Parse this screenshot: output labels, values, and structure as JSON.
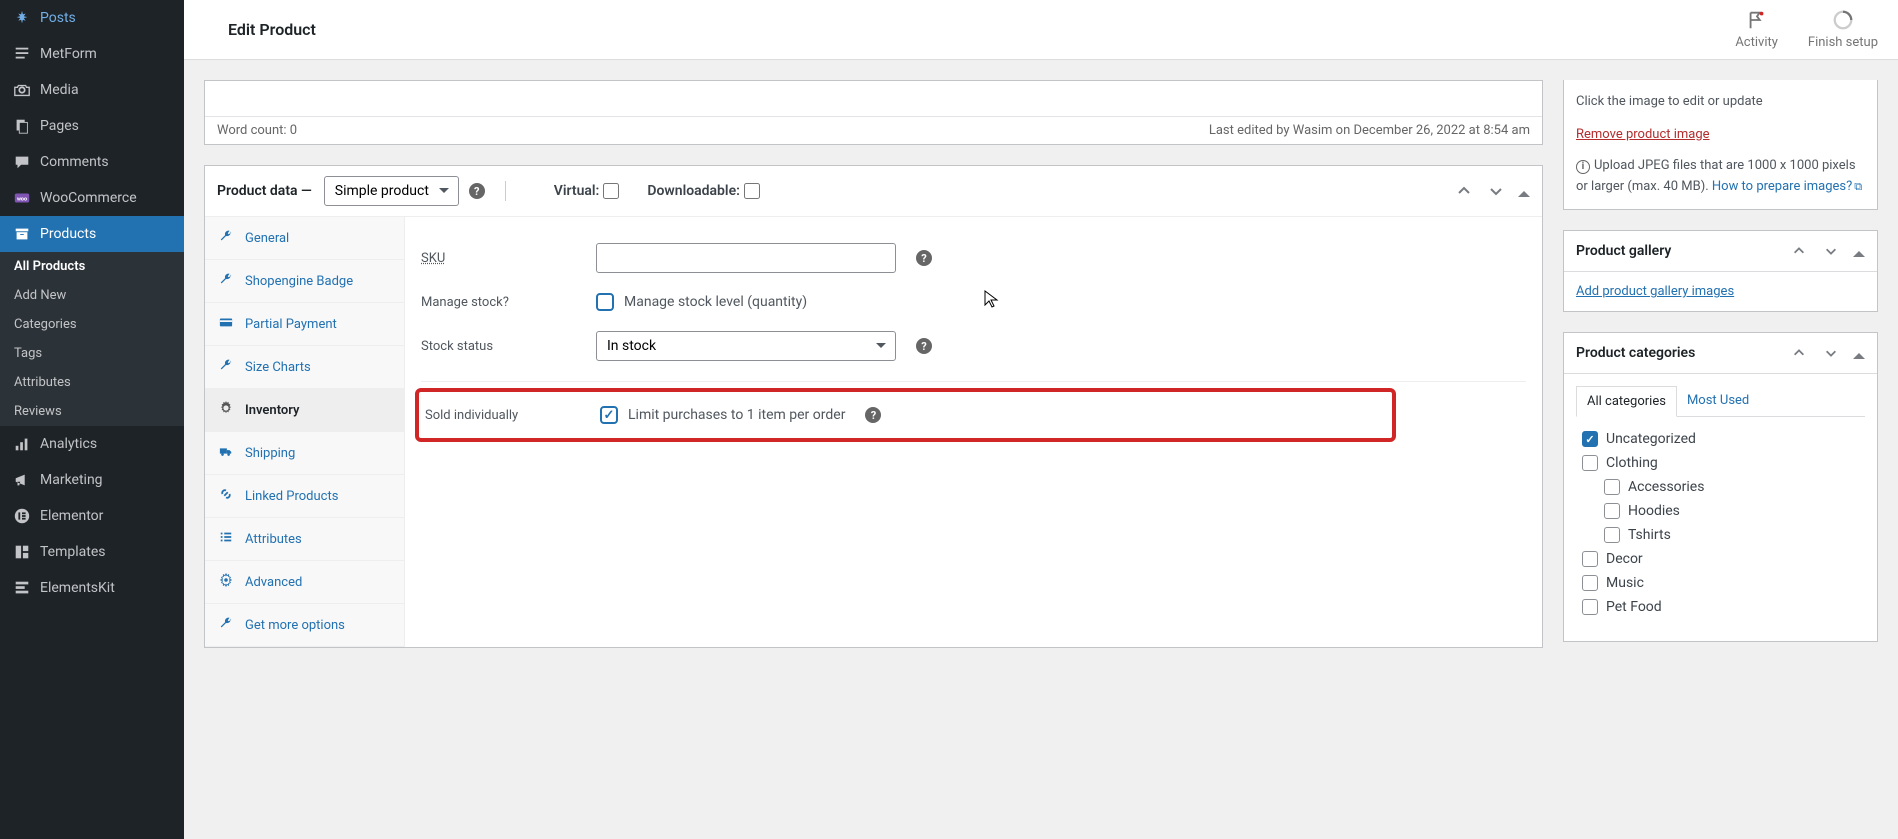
{
  "topbar": {
    "title": "Edit Product",
    "activity": "Activity",
    "finish_setup": "Finish setup"
  },
  "sidebar": {
    "items": [
      {
        "label": "Posts",
        "icon": "pin"
      },
      {
        "label": "MetForm",
        "icon": "form"
      },
      {
        "label": "Media",
        "icon": "camera"
      },
      {
        "label": "Pages",
        "icon": "pages"
      },
      {
        "label": "Comments",
        "icon": "comment"
      },
      {
        "label": "WooCommerce",
        "icon": "woo"
      },
      {
        "label": "Products",
        "icon": "archive",
        "active": true
      },
      {
        "label": "Analytics",
        "icon": "analytics"
      },
      {
        "label": "Marketing",
        "icon": "megaphone"
      },
      {
        "label": "Elementor",
        "icon": "elementor"
      },
      {
        "label": "Templates",
        "icon": "templates"
      },
      {
        "label": "ElementsKit",
        "icon": "ek"
      }
    ],
    "sub": [
      {
        "label": "All Products",
        "active": true
      },
      {
        "label": "Add New"
      },
      {
        "label": "Categories"
      },
      {
        "label": "Tags"
      },
      {
        "label": "Attributes"
      },
      {
        "label": "Reviews"
      }
    ]
  },
  "editor": {
    "word_count": "Word count: 0",
    "last_edited": "Last edited by Wasim on December 26, 2022 at 8:54 am"
  },
  "product_data": {
    "title": "Product data —",
    "type_selected": "Simple product",
    "virtual_label": "Virtual:",
    "downloadable_label": "Downloadable:",
    "tabs": [
      {
        "label": "General",
        "icon": "wrench"
      },
      {
        "label": "Shopengine Badge",
        "icon": "wrench"
      },
      {
        "label": "Partial Payment",
        "icon": "card"
      },
      {
        "label": "Size Charts",
        "icon": "wrench"
      },
      {
        "label": "Inventory",
        "icon": "gear",
        "active": true
      },
      {
        "label": "Shipping",
        "icon": "truck"
      },
      {
        "label": "Linked Products",
        "icon": "link"
      },
      {
        "label": "Attributes",
        "icon": "list"
      },
      {
        "label": "Advanced",
        "icon": "gear"
      },
      {
        "label": "Get more options",
        "icon": "wrench"
      }
    ],
    "fields": {
      "sku_label": "SKU",
      "sku_value": "",
      "manage_stock_label": "Manage stock?",
      "manage_stock_desc": "Manage stock level (quantity)",
      "manage_stock_checked": false,
      "stock_status_label": "Stock status",
      "stock_status_value": "In stock",
      "sold_individually_label": "Sold individually",
      "sold_individually_desc": "Limit purchases to 1 item per order",
      "sold_individually_checked": true
    }
  },
  "image_box": {
    "edit_text": "Click the image to edit or update",
    "remove_link": "Remove product image",
    "upload_note": "Upload JPEG files that are 1000 x 1000 pixels or larger (max. 40 MB). ",
    "prepare_link": "How to prepare images?"
  },
  "gallery": {
    "title": "Product gallery",
    "add_link": "Add product gallery images"
  },
  "categories": {
    "title": "Product categories",
    "tab_all": "All categories",
    "tab_most": "Most Used",
    "items": [
      {
        "label": "Uncategorized",
        "checked": true,
        "indent": false
      },
      {
        "label": "Clothing",
        "checked": false,
        "indent": false
      },
      {
        "label": "Accessories",
        "checked": false,
        "indent": true
      },
      {
        "label": "Hoodies",
        "checked": false,
        "indent": true
      },
      {
        "label": "Tshirts",
        "checked": false,
        "indent": true
      },
      {
        "label": "Decor",
        "checked": false,
        "indent": false
      },
      {
        "label": "Music",
        "checked": false,
        "indent": false
      },
      {
        "label": "Pet Food",
        "checked": false,
        "indent": false
      }
    ]
  }
}
